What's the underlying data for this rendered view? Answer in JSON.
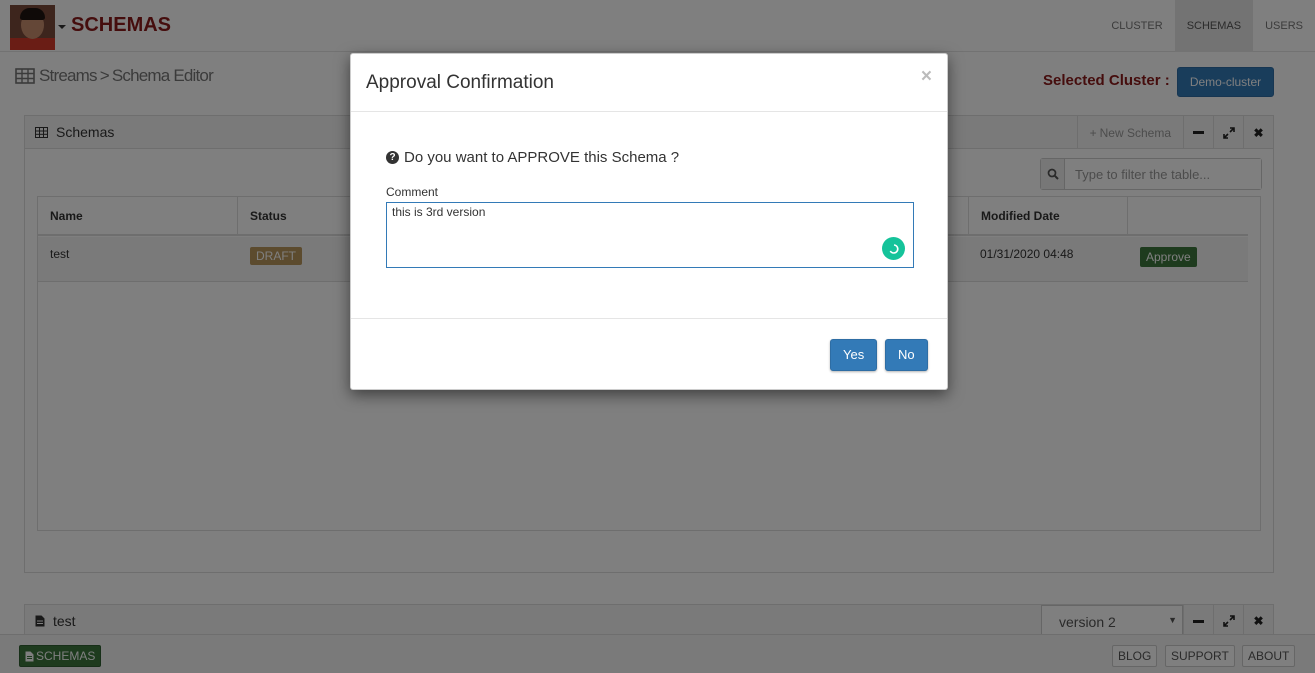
{
  "navbar": {
    "brand": "SCHEMAS",
    "items": [
      {
        "label": "CLUSTER",
        "active": false
      },
      {
        "label": "SCHEMAS",
        "active": true
      },
      {
        "label": "USERS",
        "active": false
      }
    ]
  },
  "breadcrumb": {
    "root": "Streams",
    "separator": ">",
    "current": "Schema Editor"
  },
  "cluster": {
    "label": "Selected Cluster :",
    "value": "Demo-cluster"
  },
  "schemas_panel": {
    "title": "Schemas",
    "new_schema_label": "New Schema",
    "filter_placeholder": "Type to filter the table...",
    "columns": [
      "Name",
      "Status",
      "Modified Date"
    ],
    "rows": [
      {
        "name": "test",
        "status": "DRAFT",
        "modified": "01/31/2020 04:48",
        "action": "Approve"
      }
    ]
  },
  "detail_panel": {
    "title": "test",
    "version": "version 2"
  },
  "footer": {
    "left_button": "SCHEMAS",
    "right_buttons": [
      "BLOG",
      "SUPPORT",
      "ABOUT"
    ]
  },
  "modal": {
    "title": "Approval Confirmation",
    "close": "×",
    "question": "Do you want to APPROVE this Schema ?",
    "comment_label": "Comment",
    "comment_value": "this is 3rd version",
    "yes_label": "Yes",
    "no_label": "No"
  },
  "colors": {
    "brand": "#8b1a1a",
    "primary": "#337ab7",
    "success": "#3c763d",
    "draft": "#b8975c",
    "grammarly": "#15c39a"
  },
  "icons": {
    "breadcrumb": "table-grid-icon",
    "panel": "table-grid-icon",
    "search": "search-icon",
    "question": "question-circle-icon",
    "file": "file-icon",
    "grammarly": "grammarly-icon"
  }
}
